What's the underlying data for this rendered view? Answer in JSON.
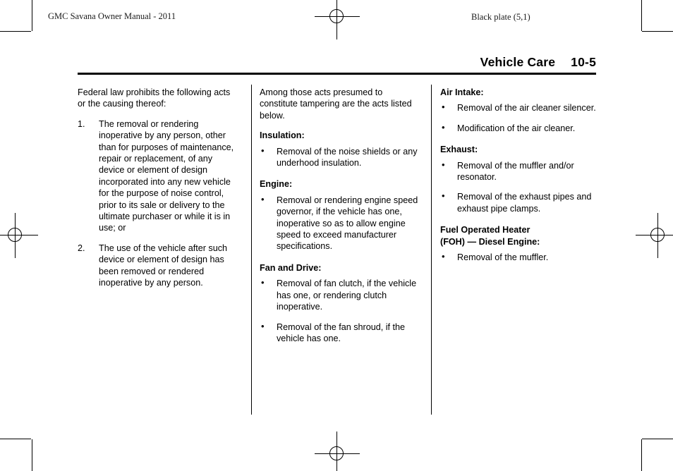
{
  "page": {
    "manual_id": "GMC Savana Owner Manual - 2011",
    "black_plate": "Black plate (5,1)",
    "chapter_title": "Vehicle Care",
    "page_number": "10-5",
    "bullet_glyph": "•"
  },
  "column_1": {
    "intro": "Federal law prohibits the following acts or the causing thereof:",
    "items": [
      {
        "number": "1.",
        "text": "The removal or rendering inoperative by any person, other than for purposes of maintenance, repair or replacement, of any device or element of design incorporated into any new vehicle for the purpose of noise control, prior to its sale or delivery to the ultimate purchaser or while it is in use; or"
      },
      {
        "number": "2.",
        "text": "The use of the vehicle after such device or element of design has been removed or rendered inoperative by any person."
      }
    ]
  },
  "column_2": {
    "intro": "Among those acts presumed to constitute tampering are the acts listed below.",
    "sections": [
      {
        "heading": "Insulation:",
        "bullets": [
          "Removal of the noise shields or any underhood insulation."
        ]
      },
      {
        "heading": "Engine:",
        "bullets": [
          "Removal or rendering engine speed governor, if the vehicle has one, inoperative so as to allow engine speed to exceed manufacturer specifications."
        ]
      },
      {
        "heading": "Fan and Drive:",
        "bullets": [
          "Removal of fan clutch, if the vehicle has one, or rendering clutch inoperative.",
          "Removal of the fan shroud, if the vehicle has one."
        ]
      }
    ]
  },
  "column_3": {
    "sections": [
      {
        "heading": "Air Intake:",
        "bullets": [
          "Removal of the air cleaner silencer.",
          "Modification of the air cleaner."
        ]
      },
      {
        "heading": "Exhaust:",
        "bullets": [
          "Removal of the muffler and/or resonator.",
          "Removal of the exhaust pipes and exhaust pipe clamps."
        ]
      },
      {
        "heading": "Fuel Operated Heater\n(FOH) — Diesel Engine:",
        "bullets": [
          "Removal of the muffler."
        ]
      }
    ]
  }
}
